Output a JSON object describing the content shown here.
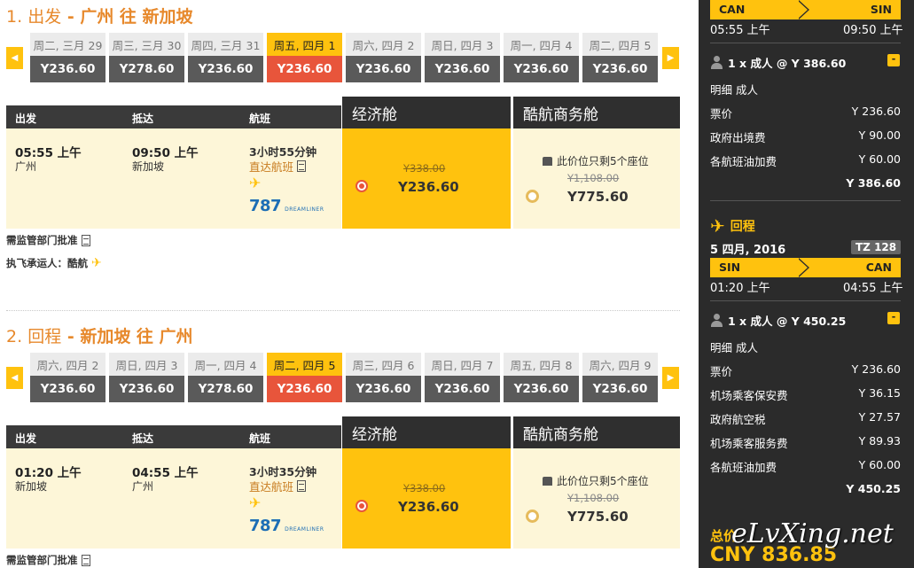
{
  "outbound": {
    "title_num": "1.",
    "title_word": "出发",
    "title_route": " - 广州 往 新加坡",
    "dates": [
      {
        "day": "周二, 三月 29",
        "price": "Y236.60",
        "selected": false
      },
      {
        "day": "周三, 三月 30",
        "price": "Y278.60",
        "selected": false
      },
      {
        "day": "周四, 三月 31",
        "price": "Y236.60",
        "selected": false
      },
      {
        "day": "周五, 四月 1",
        "price": "Y236.60",
        "selected": true
      },
      {
        "day": "周六, 四月 2",
        "price": "Y236.60",
        "selected": false
      },
      {
        "day": "周日, 四月 3",
        "price": "Y236.60",
        "selected": false
      },
      {
        "day": "周一, 四月 4",
        "price": "Y236.60",
        "selected": false
      },
      {
        "day": "周二, 四月 5",
        "price": "Y236.60",
        "selected": false
      }
    ],
    "headers": {
      "depart": "出发",
      "arrive": "抵达",
      "flight": "航班",
      "economy": "经济舱",
      "business": "酷航商务舱"
    },
    "flight": {
      "dep_time": "05:55 上午",
      "dep_city": "广州",
      "arr_time": "09:50 上午",
      "arr_city": "新加坡",
      "duration": "3小时55分钟",
      "direct": "直达航班",
      "aircraft": "787",
      "aircraft_sub": "DREAMLINER",
      "eco_old": "Y338.00",
      "eco_price": "Y236.60",
      "biz_note": "此价位只剩5个座位",
      "biz_old": "Y1,108.00",
      "biz_price": "Y775.60"
    },
    "approval": "需监管部门批准",
    "operator": "执飞承运人：酷航"
  },
  "return": {
    "title_num": "2.",
    "title_word": "回程",
    "title_route": " - 新加坡 往 广州",
    "dates": [
      {
        "day": "周六, 四月 2",
        "price": "Y236.60",
        "selected": false
      },
      {
        "day": "周日, 四月 3",
        "price": "Y236.60",
        "selected": false
      },
      {
        "day": "周一, 四月 4",
        "price": "Y278.60",
        "selected": false
      },
      {
        "day": "周二, 四月 5",
        "price": "Y236.60",
        "selected": true
      },
      {
        "day": "周三, 四月 6",
        "price": "Y236.60",
        "selected": false
      },
      {
        "day": "周日, 四月 7",
        "price": "Y236.60",
        "selected": false
      },
      {
        "day": "周五, 四月 8",
        "price": "Y236.60",
        "selected": false
      },
      {
        "day": "周六, 四月 9",
        "price": "Y236.60",
        "selected": false
      }
    ],
    "headers": {
      "depart": "出发",
      "arrive": "抵达",
      "flight": "航班",
      "economy": "经济舱",
      "business": "酷航商务舱"
    },
    "flight": {
      "dep_time": "01:20 上午",
      "dep_city": "新加坡",
      "arr_time": "04:55 上午",
      "arr_city": "广州",
      "duration": "3小时35分钟",
      "direct": "直达航班",
      "aircraft": "787",
      "aircraft_sub": "DREAMLINER",
      "eco_old": "Y338.00",
      "eco_price": "Y236.60",
      "biz_note": "此价位只剩5个座位",
      "biz_old": "Y1,108.00",
      "biz_price": "Y775.60"
    },
    "approval": "需监管部门批准"
  },
  "sidebar": {
    "out_from": "CAN",
    "out_to": "SIN",
    "out_dep": "05:55 上午",
    "out_arr": "09:50 上午",
    "out_pax": "1 x 成人 @ Y 386.60",
    "toggle": "-",
    "detail_label": "明细 成人",
    "out_items": [
      {
        "label": "票价",
        "value": "Y 236.60"
      },
      {
        "label": "政府出境费",
        "value": "Y 90.00"
      },
      {
        "label": "各航班油加费",
        "value": "Y 60.00"
      }
    ],
    "out_total": "Y 386.60",
    "return_label": "回程",
    "ret_date": "5 四月, 2016",
    "ret_flight_no": "TZ 128",
    "ret_from": "SIN",
    "ret_to": "CAN",
    "ret_dep": "01:20 上午",
    "ret_arr": "04:55 上午",
    "ret_pax": "1 x 成人 @ Y 450.25",
    "ret_items": [
      {
        "label": "票价",
        "value": "Y 236.60"
      },
      {
        "label": "机场乘客保安费",
        "value": "Y 36.15"
      },
      {
        "label": "政府航空税",
        "value": "Y 27.57"
      },
      {
        "label": "机场乘客服务费",
        "value": "Y 89.93"
      },
      {
        "label": "各航班油加费",
        "value": "Y 60.00"
      }
    ],
    "ret_total": "Y 450.25",
    "total_label": "总价",
    "total_value": "CNY 836.85"
  },
  "watermark": "eLvXing.net",
  "colors": {
    "accent": "#ffc20e",
    "selected": "#e8553b",
    "title": "#e7892c",
    "dark": "#2b2b2b"
  }
}
